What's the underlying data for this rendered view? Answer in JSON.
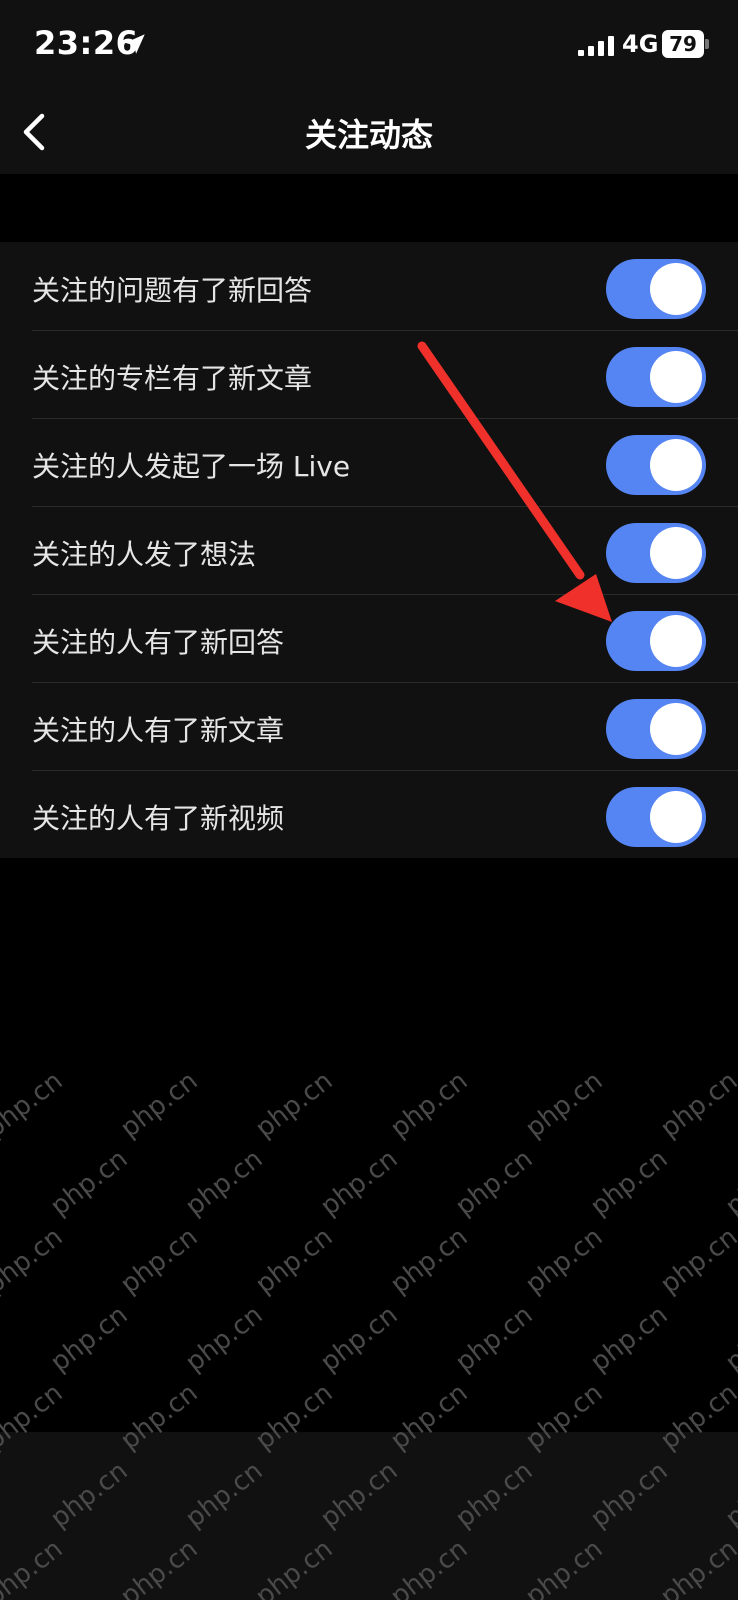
{
  "status_bar": {
    "time": "23:26",
    "network": "4G",
    "battery": "79",
    "icons": [
      "location-arrow-icon",
      "signal-icon",
      "battery-icon"
    ]
  },
  "nav": {
    "title": "关注动态",
    "back_icon": "chevron-left-icon"
  },
  "settings": {
    "items": [
      {
        "label": "关注的问题有了新回答",
        "enabled": true
      },
      {
        "label": "关注的专栏有了新文章",
        "enabled": true
      },
      {
        "label": "关注的人发起了一场 Live",
        "enabled": true
      },
      {
        "label": "关注的人发了想法",
        "enabled": true
      },
      {
        "label": "关注的人有了新回答",
        "enabled": true
      },
      {
        "label": "关注的人有了新文章",
        "enabled": true
      },
      {
        "label": "关注的人有了新视频",
        "enabled": true
      }
    ]
  },
  "annotation": {
    "type": "red-arrow",
    "color": "#f0302a",
    "points_to_item": 4
  },
  "watermark": {
    "text": "php.cn"
  },
  "colors": {
    "toggle_on": "#5584f3",
    "background": "#000000",
    "surface": "#111111"
  }
}
